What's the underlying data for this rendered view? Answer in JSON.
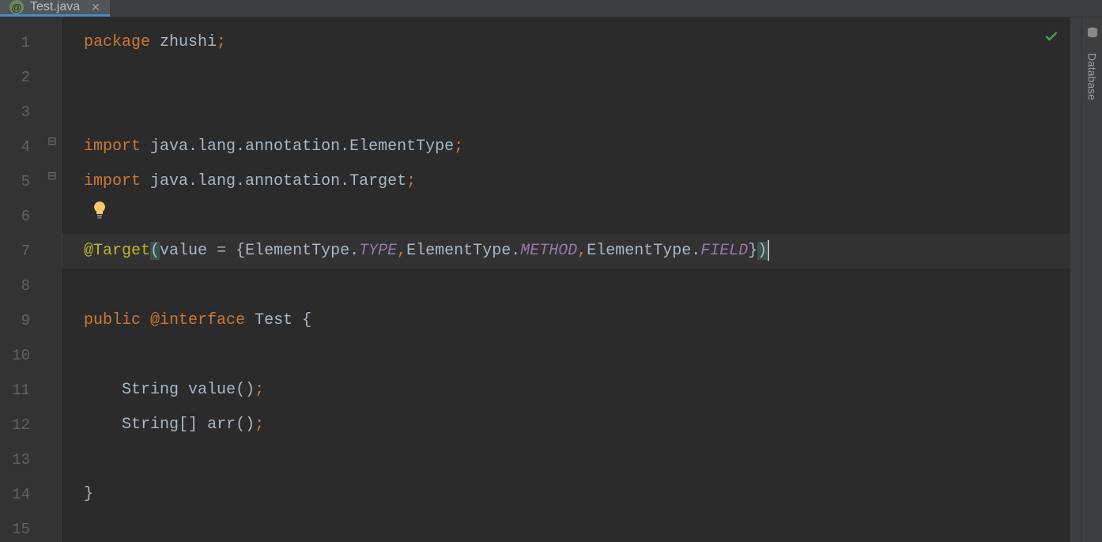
{
  "tab": {
    "icon": "@",
    "filename": "Test.java"
  },
  "gutter": {
    "lines": [
      "1",
      "2",
      "3",
      "4",
      "5",
      "6",
      "7",
      "8",
      "9",
      "10",
      "11",
      "12",
      "13",
      "14",
      "15"
    ]
  },
  "code": {
    "l1": {
      "kw": "package",
      "pkg": "zhushi"
    },
    "l4": {
      "kw": "import",
      "path": "java.lang.annotation.ElementType"
    },
    "l5": {
      "kw": "import",
      "path_prefix": "java.lang.annotation.",
      "cls": "Target"
    },
    "l7": {
      "ann": "@Target",
      "attr": "value",
      "elems_prefix": "ElementType.",
      "c1": "TYPE",
      "c2": "METHOD",
      "c3": "FIELD"
    },
    "l9": {
      "kw1": "public",
      "kw2": "@interface",
      "name": "Test"
    },
    "l11": {
      "type": "String",
      "name": "value"
    },
    "l12": {
      "type": "String",
      "name": "arr"
    }
  },
  "sidebar": {
    "tool": "Database"
  }
}
